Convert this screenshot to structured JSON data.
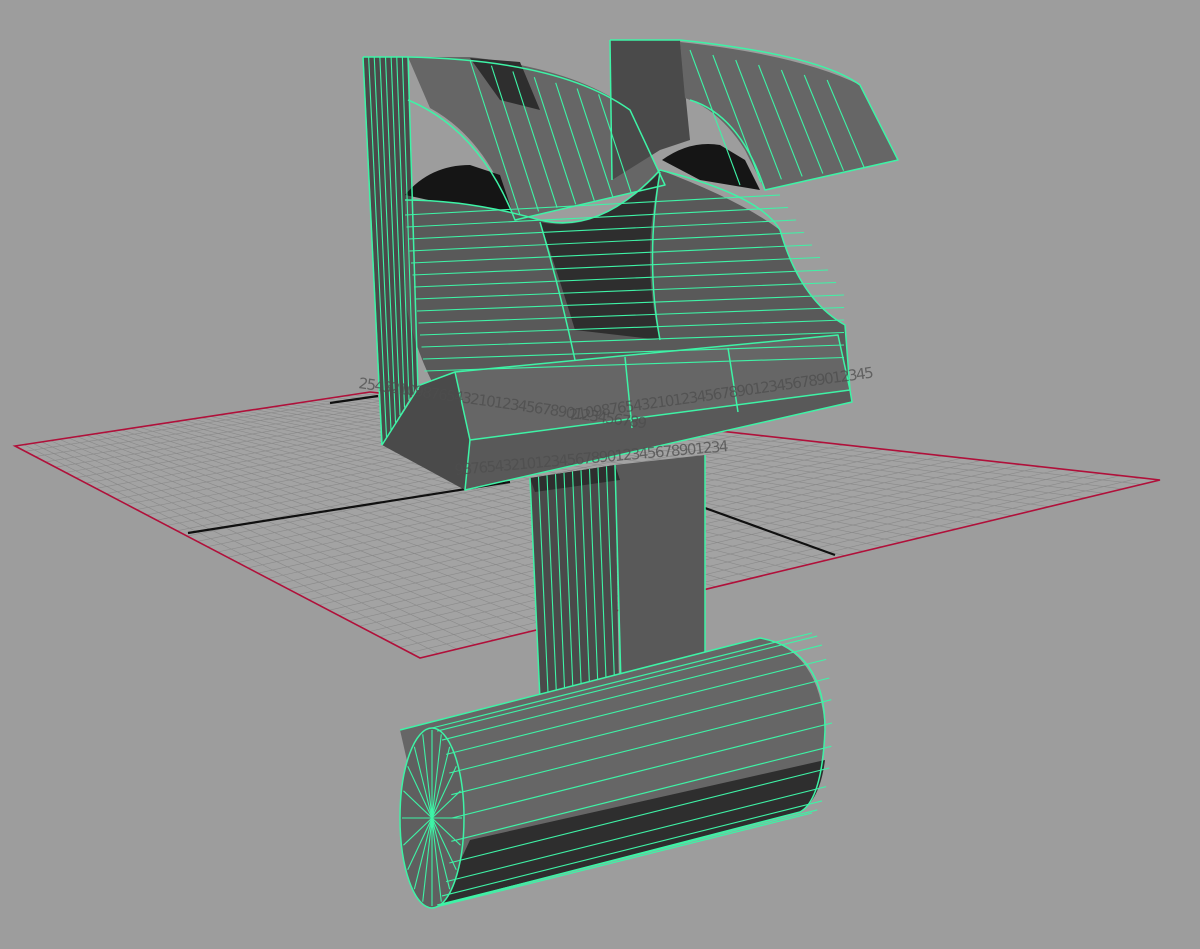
{
  "viewport": {
    "background": "#9d9d9d",
    "wireframe_color": "#3ef3a6",
    "grid_border_color": "#b0103a",
    "grid_axis_color": "#101010",
    "hud_overlays": [
      {
        "text": "254321098765432101234567890123456789",
        "mode": "upper"
      },
      {
        "text": "21098765432101234567890123456789012345",
        "mode": "middle"
      },
      {
        "text": "9876543210123456789012345678901234",
        "mode": "lower"
      }
    ]
  }
}
